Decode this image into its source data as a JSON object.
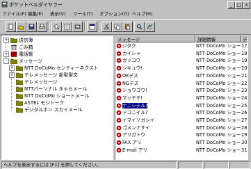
{
  "window": {
    "title": "ポケットベルダイヤラー",
    "controls": {
      "minimize": "_",
      "maximize": "□",
      "close": "×"
    }
  },
  "menu": [
    "ファイル(F)",
    "編集(E)",
    "表示(V)",
    "ツール(T)",
    "オプション(O)",
    "ヘルプ(H)"
  ],
  "toolbar": {
    "buttons": [
      "new-icon",
      "open-icon",
      "save-icon",
      "print-icon",
      "print-preview-icon",
      "properties-icon",
      "dial-icon",
      "view-icon",
      "cut-icon",
      "copy-icon",
      "paste-icon",
      "find-icon",
      "help-icon"
    ]
  },
  "tree": {
    "items": [
      {
        "label": "送信簿",
        "expander": "+"
      },
      {
        "label": "ごみ箱",
        "expander": ""
      },
      {
        "label": "電話帳",
        "expander": "+"
      },
      {
        "label": "メッセージ",
        "expander": "-"
      },
      {
        "label": "NTT DoCoMo センティーネクスト",
        "expander": "+"
      },
      {
        "label": "テレメッセージ 新型型文",
        "expander": "+"
      },
      {
        "label": "テレメッセージ",
        "expander": ""
      },
      {
        "label": "NTTパーソナル きゃらメール",
        "expander": ""
      },
      {
        "label": "NTT DoCoMo ショートメール",
        "expander": ""
      },
      {
        "label": "ASTEL モジトーク",
        "expander": ""
      },
      {
        "label": "デジタルホン スカイメール",
        "expander": ""
      }
    ]
  },
  "list": {
    "columns": [
      "メッセージ",
      "詳細情報",
      "デ"
    ],
    "rows": [
      {
        "name": "ジタク",
        "detail": "NTT DoCoMo ショートメ",
        "extra": "17"
      },
      {
        "name": "カイシャ",
        "detail": "NTT DoCoMo ショートメ",
        "extra": "18"
      },
      {
        "name": "ガッコウ",
        "detail": "NTT DoCoMo ショートメ",
        "extra": "19"
      },
      {
        "name": "シキュウ!",
        "detail": "NTT DoCoMo ショートメ",
        "extra": "20"
      },
      {
        "name": "OKデス",
        "detail": "NTT DoCoMo ショートメ",
        "extra": "21"
      },
      {
        "name": "NGデス",
        "detail": "NTT DoCoMo ショートメ",
        "extra": "22"
      },
      {
        "name": "ショウゴウ!",
        "detail": "NTT DoCoMo ショートメ",
        "extra": "23"
      },
      {
        "name": "マッテテ!",
        "detail": "NTT DoCoMo ショートメ",
        "extra": "24"
      },
      {
        "name": "ナニシテル?",
        "detail": "NTT DoCoMo ショートメ",
        "extra": "25",
        "selected": true
      },
      {
        "name": "ドコニイル?",
        "detail": "NTT DoCoMo ショートメ",
        "extra": "26"
      },
      {
        "name": "イマイソガシイ",
        "detail": "NTT DoCoMo ショートメ",
        "extra": "27"
      },
      {
        "name": "ゴメンナサイ",
        "detail": "NTT DoCoMo ショートメ",
        "extra": "28"
      },
      {
        "name": "アリガトウ",
        "detail": "NTT DoCoMo ショートメ",
        "extra": "29"
      },
      {
        "name": "FAX アリ",
        "detail": "NTT DoCoMo ショートメ",
        "extra": "30"
      },
      {
        "name": "E-mail アリ",
        "detail": "NTT DoCoMo ショートメ",
        "extra": "31"
      }
    ]
  },
  "status": {
    "text": "ヘルプを表示するには [F1] を押してください。"
  },
  "colors": {
    "selection": "#000080",
    "message_icon": "#b00000"
  }
}
